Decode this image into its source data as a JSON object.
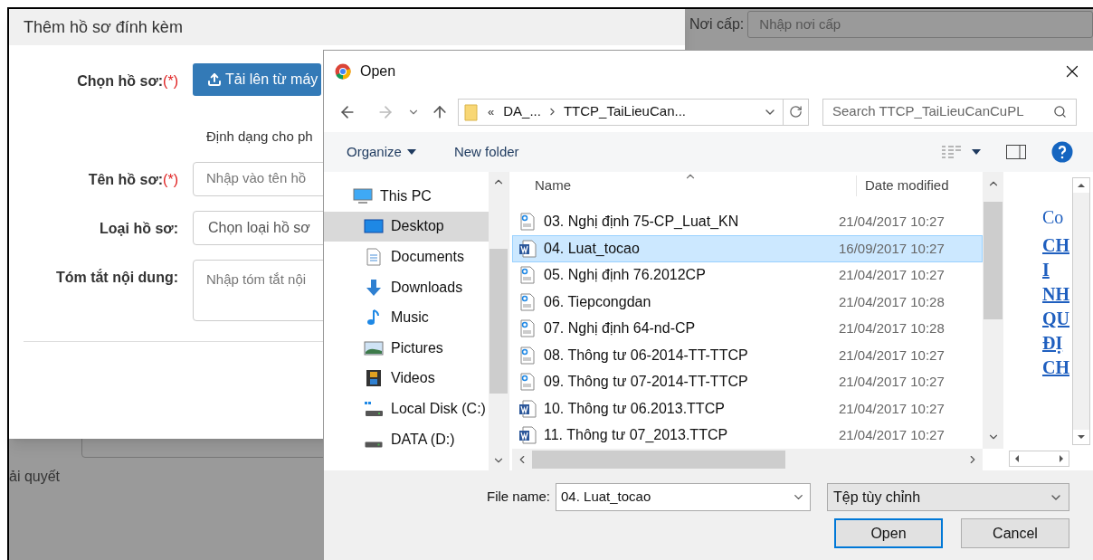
{
  "background_page": {
    "issue_place_label": "Nơi cấp:",
    "issue_place_placeholder": "Nhập nơi cấp",
    "partial_text": "ải quyết"
  },
  "attach_modal": {
    "title": "Thêm hồ sơ đính kèm",
    "upload_label": "Chọn hồ sơ:",
    "upload_required_mark": "(*)",
    "upload_button": "Tải lên từ máy",
    "format_note": "Định dạng cho ph",
    "fields": [
      {
        "label": "Tên hồ sơ:",
        "required_mark": "(*)",
        "placeholder": "Nhập vào tên hồ",
        "kind": "input"
      },
      {
        "label": "Loại hồ sơ:",
        "placeholder": "Chọn loại hồ sơ",
        "kind": "select"
      },
      {
        "label": "Tóm tắt nội dung:",
        "placeholder": "Nhập tóm tắt nội",
        "kind": "textarea"
      }
    ]
  },
  "open_dialog": {
    "title": "Open",
    "address": {
      "overflow": "«",
      "crumbs": [
        "DA_...",
        "TTCP_TaiLieuCan..."
      ]
    },
    "search": {
      "placeholder": "Search TTCP_TaiLieuCanCuPL"
    },
    "toolbar": {
      "organize": "Organize",
      "new_folder": "New folder"
    },
    "nav_tree": [
      {
        "label": "This PC",
        "kind": "pc",
        "selected": false,
        "children": [
          {
            "label": "Desktop",
            "kind": "desktop",
            "selected": true
          },
          {
            "label": "Documents",
            "kind": "documents",
            "selected": false
          },
          {
            "label": "Downloads",
            "kind": "downloads",
            "selected": false
          },
          {
            "label": "Music",
            "kind": "music",
            "selected": false
          },
          {
            "label": "Pictures",
            "kind": "pictures",
            "selected": false
          },
          {
            "label": "Videos",
            "kind": "videos",
            "selected": false
          },
          {
            "label": "Local Disk (C:)",
            "kind": "system-disk",
            "selected": false
          },
          {
            "label": "DATA (D:)",
            "kind": "disk",
            "selected": false
          }
        ]
      }
    ],
    "columns": [
      "Name",
      "Date modified"
    ],
    "files": [
      {
        "name": "03. Nghị định 75-CP_Luat_KN",
        "date": "21/04/2017 10:27",
        "kind": "pdf",
        "selected": false
      },
      {
        "name": "04. Luat_tocao",
        "date": "16/09/2017 10:27",
        "kind": "word",
        "selected": true
      },
      {
        "name": "05. Nghị định 76.2012CP",
        "date": "21/04/2017 10:27",
        "kind": "pdf",
        "selected": false
      },
      {
        "name": "06. Tiepcongdan",
        "date": "21/04/2017 10:28",
        "kind": "pdf",
        "selected": false
      },
      {
        "name": "07. Nghị định 64-nd-CP",
        "date": "21/04/2017 10:28",
        "kind": "pdf",
        "selected": false
      },
      {
        "name": "08. Thông tư 06-2014-TT-TTCP",
        "date": "21/04/2017 10:27",
        "kind": "pdf",
        "selected": false
      },
      {
        "name": "09. Thông tư 07-2014-TT-TTCP",
        "date": "21/04/2017 10:27",
        "kind": "pdf",
        "selected": false
      },
      {
        "name": "10. Thông tư 06.2013.TTCP",
        "date": "21/04/2017 10:27",
        "kind": "word",
        "selected": false
      },
      {
        "name": "11. Thông tư 07_2013.TTCP",
        "date": "21/04/2017 10:27",
        "kind": "word",
        "selected": false
      }
    ],
    "preview_lines": [
      {
        "text": "Co",
        "kind": "plain"
      },
      {
        "text": "CH",
        "kind": "link"
      },
      {
        "text": "I",
        "kind": "link"
      },
      {
        "text": "NH",
        "kind": "link"
      },
      {
        "text": "QU",
        "kind": "link"
      },
      {
        "text": "ĐỊ",
        "kind": "link"
      },
      {
        "text": "CH",
        "kind": "link"
      }
    ],
    "file_name_label": "File name:",
    "file_name": "04. Luat_tocao",
    "file_type": "Tệp tùy chỉnh",
    "buttons": [
      {
        "label": "Open",
        "default": true
      },
      {
        "label": "Cancel",
        "default": false
      }
    ]
  }
}
